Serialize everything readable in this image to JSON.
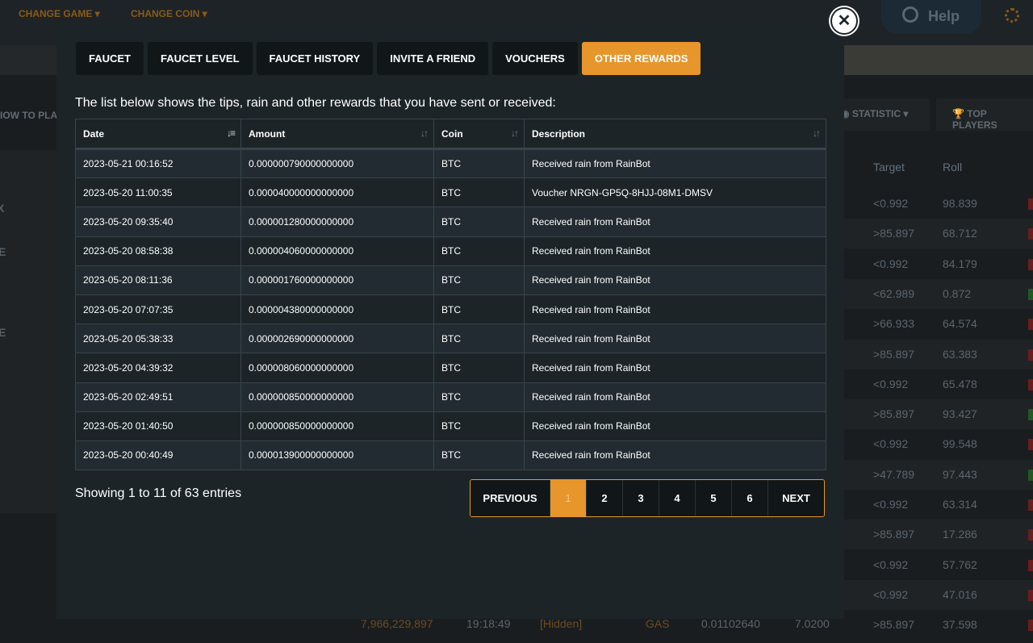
{
  "background": {
    "nav": [
      "CHANGE GAME",
      "CHANGE COIN"
    ],
    "help_label": "Help",
    "left_labels": [
      "IOW TO PLAY"
    ],
    "left_buttons": [
      "X",
      "E",
      "E"
    ],
    "statistic_label": "STATISTIC",
    "top_players_label": "TOP PLAYERS",
    "table_headers": [
      "Target",
      "Roll"
    ],
    "rows": [
      {
        "target": "<0.992",
        "roll": "98.839",
        "win": false
      },
      {
        "target": ">85.897",
        "roll": "68.712",
        "win": false
      },
      {
        "target": "<0.992",
        "roll": "84.179",
        "win": false
      },
      {
        "target": "<62.989",
        "roll": "0.872",
        "win": true
      },
      {
        "target": ">66.933",
        "roll": "64.574",
        "win": false
      },
      {
        "target": ">85.897",
        "roll": "63.383",
        "win": false
      },
      {
        "target": "<0.992",
        "roll": "65.478",
        "win": false
      },
      {
        "target": ">85.897",
        "roll": "93.427",
        "win": true
      },
      {
        "target": "<0.992",
        "roll": "99.548",
        "win": false
      },
      {
        "target": ">47.789",
        "roll": "97.443",
        "win": true
      },
      {
        "target": "<0.992",
        "roll": "63.314",
        "win": false
      },
      {
        "target": ">85.897",
        "roll": "17.286",
        "win": false
      },
      {
        "target": "<0.992",
        "roll": "57.762",
        "win": false
      },
      {
        "target": "<0.992",
        "roll": "47.016",
        "win": false
      },
      {
        "target": ">85.897",
        "roll": "37.598",
        "win": false
      }
    ],
    "bottom_row": {
      "bet_id": "7,966,229,897",
      "time": "19:18:49",
      "user": "[Hidden]",
      "coin": "GAS",
      "amount": "0.01102640",
      "payout": "7.0200"
    }
  },
  "modal": {
    "tabs": [
      {
        "label": "FAUCET",
        "active": false
      },
      {
        "label": "FAUCET LEVEL",
        "active": false
      },
      {
        "label": "FAUCET HISTORY",
        "active": false
      },
      {
        "label": "INVITE A FRIEND",
        "active": false
      },
      {
        "label": "VOUCHERS",
        "active": false
      },
      {
        "label": "OTHER REWARDS",
        "active": true
      }
    ],
    "intro": "The list below shows the tips, rain and other rewards that you have sent or received:",
    "columns": [
      "Date",
      "Amount",
      "Coin",
      "Description"
    ],
    "rows": [
      {
        "date": "2023-05-21 00:16:52",
        "amount": "0.000000790000000000",
        "coin": "BTC",
        "description": "Received rain from RainBot"
      },
      {
        "date": "2023-05-20 11:00:35",
        "amount": "0.000040000000000000",
        "coin": "BTC",
        "description": "Voucher NRGN-GP5Q-8HJJ-08M1-DMSV"
      },
      {
        "date": "2023-05-20 09:35:40",
        "amount": "0.000001280000000000",
        "coin": "BTC",
        "description": "Received rain from RainBot"
      },
      {
        "date": "2023-05-20 08:58:38",
        "amount": "0.000004060000000000",
        "coin": "BTC",
        "description": "Received rain from RainBot"
      },
      {
        "date": "2023-05-20 08:11:36",
        "amount": "0.000001760000000000",
        "coin": "BTC",
        "description": "Received rain from RainBot"
      },
      {
        "date": "2023-05-20 07:07:35",
        "amount": "0.000004380000000000",
        "coin": "BTC",
        "description": "Received rain from RainBot"
      },
      {
        "date": "2023-05-20 05:38:33",
        "amount": "0.000002690000000000",
        "coin": "BTC",
        "description": "Received rain from RainBot"
      },
      {
        "date": "2023-05-20 04:39:32",
        "amount": "0.000008060000000000",
        "coin": "BTC",
        "description": "Received rain from RainBot"
      },
      {
        "date": "2023-05-20 02:49:51",
        "amount": "0.000000850000000000",
        "coin": "BTC",
        "description": "Received rain from RainBot"
      },
      {
        "date": "2023-05-20 01:40:50",
        "amount": "0.000000850000000000",
        "coin": "BTC",
        "description": "Received rain from RainBot"
      },
      {
        "date": "2023-05-20 00:40:49",
        "amount": "0.000013900000000000",
        "coin": "BTC",
        "description": "Received rain from RainBot"
      }
    ],
    "showing": "Showing 1 to 11 of 63 entries",
    "pagination": {
      "previous": "PREVIOUS",
      "pages": [
        "1",
        "2",
        "3",
        "4",
        "5",
        "6"
      ],
      "current": "1",
      "next": "NEXT"
    },
    "close_icon": "close-icon"
  },
  "colors": {
    "accent": "#e7962c",
    "modal_bg": "#1c2428",
    "row_alt": "#212b31",
    "tab_bg": "#111719"
  }
}
